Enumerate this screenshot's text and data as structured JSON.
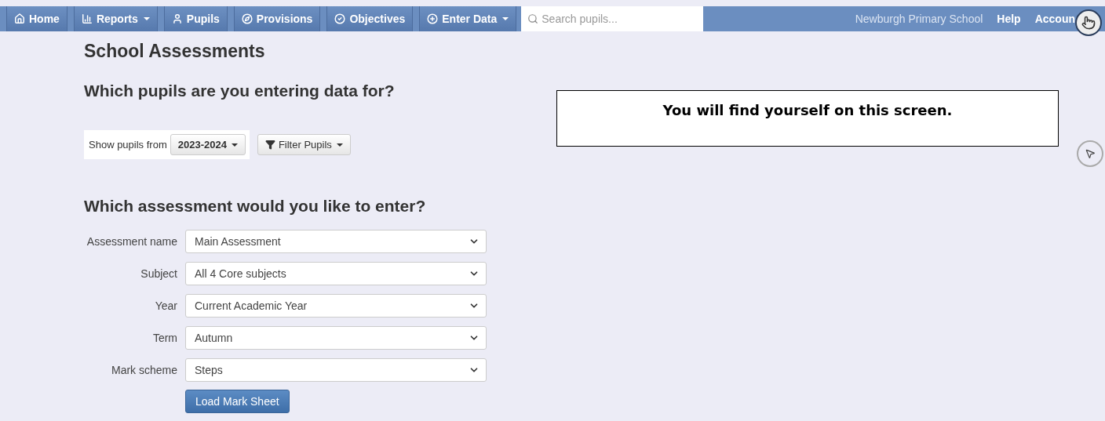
{
  "navbar": {
    "items": [
      {
        "label": "Home",
        "kind": "home",
        "dropdown": false
      },
      {
        "label": "Reports",
        "kind": "chart",
        "dropdown": true
      },
      {
        "label": "Pupils",
        "kind": "user",
        "dropdown": false
      },
      {
        "label": "Provisions",
        "kind": "compass",
        "dropdown": false
      },
      {
        "label": "Objectives",
        "kind": "check",
        "dropdown": false
      },
      {
        "label": "Enter Data",
        "kind": "plus",
        "dropdown": true
      }
    ],
    "search": {
      "placeholder": "Search pupils..."
    },
    "right_links": [
      "Newburgh Primary School",
      "Help",
      "Accoun"
    ]
  },
  "page_title": "School Assessments",
  "pupils_section": {
    "heading": "Which pupils are you entering data for?",
    "show_label": "Show pupils from",
    "year_button": "2023-2024",
    "filter_button": "Filter Pupils"
  },
  "assessment_section": {
    "heading": "Which assessment would you like to enter?",
    "fields": [
      {
        "label": "Assessment name",
        "value": "Main Assessment"
      },
      {
        "label": "Subject",
        "value": "All 4 Core subjects"
      },
      {
        "label": "Year",
        "value": "Current Academic Year"
      },
      {
        "label": "Term",
        "value": "Autumn"
      },
      {
        "label": "Mark scheme",
        "value": "Steps"
      }
    ],
    "submit_button": "Load Mark Sheet"
  },
  "callout": "You will find yourself on this screen."
}
